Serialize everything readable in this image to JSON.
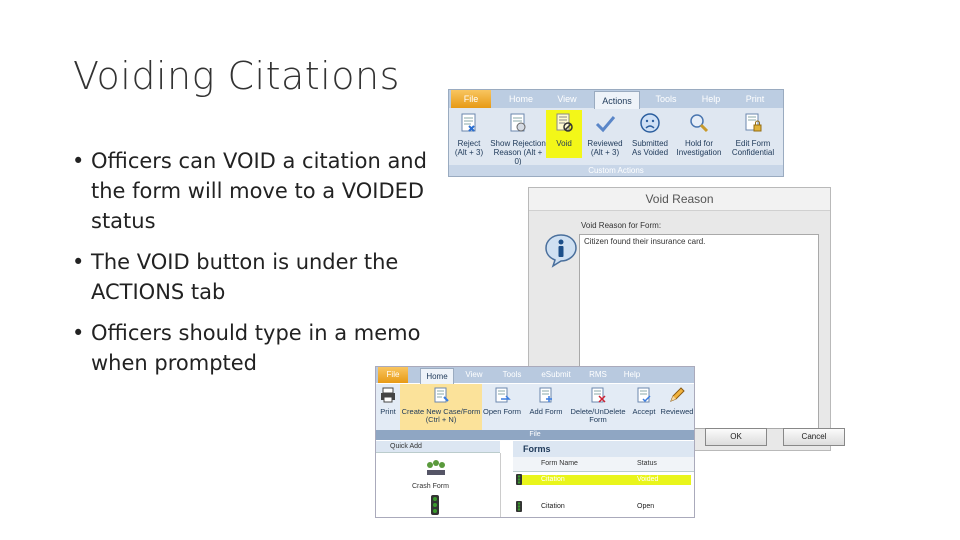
{
  "slide": {
    "title": "Voiding Citations",
    "bullets": [
      "Officers can VOID a citation and the form will move to a VOIDED status",
      "The VOID button is under the ACTIONS tab",
      "Officers should type in a memo when prompted"
    ],
    "bullet_glyph": "•"
  },
  "actions_ribbon": {
    "tabs": [
      "File",
      "Home",
      "View",
      "Actions",
      "Tools",
      "Help",
      "Print"
    ],
    "active_tab": "Actions",
    "buttons": [
      {
        "line1": "Reject",
        "line2": "(Alt + 3)",
        "icon": "reject-document-icon"
      },
      {
        "line1": "Show Rejection",
        "line2": "Reason (Alt + 0)",
        "icon": "rejection-reason-icon"
      },
      {
        "line1": "Void",
        "line2": "",
        "icon": "void-document-icon"
      },
      {
        "line1": "Reviewed",
        "line2": "(Alt + 3)",
        "icon": "checkmark-icon"
      },
      {
        "line1": "Submitted",
        "line2": "As Voided",
        "icon": "sad-face-icon"
      },
      {
        "line1": "Hold for",
        "line2": "Investigation",
        "icon": "magnifier-icon"
      },
      {
        "line1": "Edit Form",
        "line2": "Confidential",
        "icon": "lock-document-icon"
      }
    ],
    "group_label": "Custom Actions",
    "highlight_color": "#f3f718"
  },
  "void_dialog": {
    "title": "Void Reason",
    "label": "Void Reason for Form:",
    "value": "Citizen found their insurance card.",
    "icon": "info-icon",
    "ok_label": "OK",
    "cancel_label": "Cancel"
  },
  "home_ribbon": {
    "tabs": [
      "File",
      "Home",
      "View",
      "Tools",
      "eSubmit",
      "RMS",
      "Help"
    ],
    "active_tab": "Home",
    "buttons": [
      {
        "line1": "Print",
        "line2": "",
        "icon": "printer-icon"
      },
      {
        "line1": "Create New Case/Form",
        "line2": "(Ctrl + N)",
        "icon": "new-form-icon"
      },
      {
        "line1": "Open Form",
        "line2": "",
        "icon": "open-form-icon"
      },
      {
        "line1": "Add Form",
        "line2": "",
        "icon": "add-form-icon"
      },
      {
        "line1": "Delete/UnDelete",
        "line2": "Form",
        "icon": "delete-form-icon"
      },
      {
        "line1": "Accept",
        "line2": "",
        "icon": "accept-icon"
      },
      {
        "line1": "Reviewed",
        "line2": "",
        "icon": "pencil-icon"
      }
    ],
    "group_label": "File",
    "quick_add": {
      "title": "Quick Add",
      "items": [
        "Crash Form"
      ]
    },
    "forms": {
      "title": "Forms",
      "columns": [
        "Form Name",
        "Status"
      ],
      "rows": [
        {
          "name": "Citation",
          "status": "Voided"
        },
        {
          "name": "Citation",
          "status": "Open"
        }
      ]
    },
    "highlight_color": "#e9f51b"
  }
}
